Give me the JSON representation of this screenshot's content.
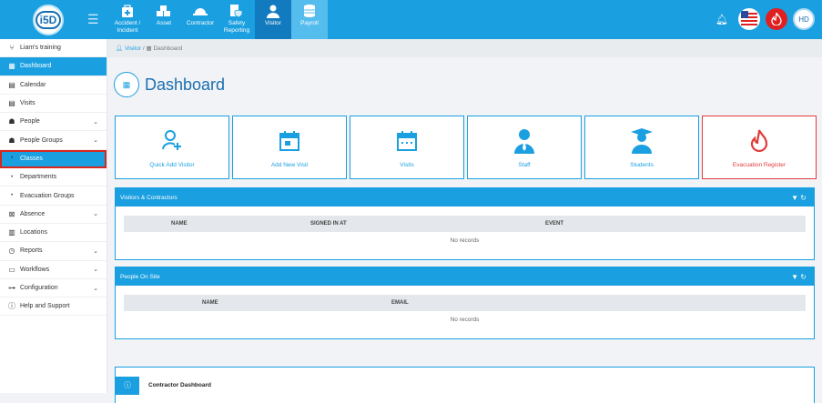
{
  "nav": {
    "items": [
      {
        "label": "Accident / Incident",
        "icon": "first-aid-kit-icon"
      },
      {
        "label": "Asset",
        "icon": "boxes-icon"
      },
      {
        "label": "Contractor",
        "icon": "hard-hat-icon"
      },
      {
        "label": "Safety Reporting",
        "icon": "shield-report-icon"
      },
      {
        "label": "Visitor",
        "icon": "person-icon"
      },
      {
        "label": "Payroll",
        "icon": "coins-icon"
      }
    ],
    "active": "Visitor",
    "colors": {
      "accent": "#1a9fe0",
      "active": "#127abf",
      "danger": "#e23b3b"
    }
  },
  "user": {
    "initials": "HD"
  },
  "sidebar": {
    "items": [
      {
        "label": "Liam's training",
        "icon": "branch-icon"
      },
      {
        "label": "Dashboard",
        "icon": "dashboard-icon"
      },
      {
        "label": "Calendar",
        "icon": "calendar-icon"
      },
      {
        "label": "Visits",
        "icon": "visits-icon"
      },
      {
        "label": "People",
        "icon": "people-icon"
      },
      {
        "label": "People Groups",
        "icon": "people-groups-icon"
      },
      {
        "label": "Classes",
        "icon": "dot-icon"
      },
      {
        "label": "Departments",
        "icon": "dot-icon"
      },
      {
        "label": "Evacuation Groups",
        "icon": "dot-icon"
      },
      {
        "label": "Absence",
        "icon": "absence-icon"
      },
      {
        "label": "Locations",
        "icon": "building-icon"
      },
      {
        "label": "Reports",
        "icon": "clock-icon"
      },
      {
        "label": "Workflows",
        "icon": "workflow-icon"
      },
      {
        "label": "Configuration",
        "icon": "toggle-icon"
      },
      {
        "label": "Help and Support",
        "icon": "help-icon"
      }
    ]
  },
  "breadcrumb": {
    "root": "Visitor",
    "sep": "/",
    "current": "Dashboard"
  },
  "page": {
    "title": "Dashboard"
  },
  "cards": [
    {
      "label": "Quick Add Visitor",
      "icon": "add-user-icon"
    },
    {
      "label": "Add New Visit",
      "icon": "calendar-add-icon"
    },
    {
      "label": "Visits",
      "icon": "calendar-icon"
    },
    {
      "label": "Staff",
      "icon": "staff-icon"
    },
    {
      "label": "Students",
      "icon": "graduate-icon"
    },
    {
      "label": "Evacuation Register",
      "icon": "flame-icon"
    }
  ],
  "visitors_panel": {
    "title": "Visitors & Contractors",
    "columns": [
      "NAME",
      "SIGNED IN AT",
      "EVENT"
    ],
    "empty": "No records"
  },
  "onsite_panel": {
    "title": "People On Site",
    "columns": [
      "NAME",
      "EMAIL"
    ],
    "empty": "No records"
  },
  "contractor_panel": {
    "title": "Contractor Dashboard"
  }
}
